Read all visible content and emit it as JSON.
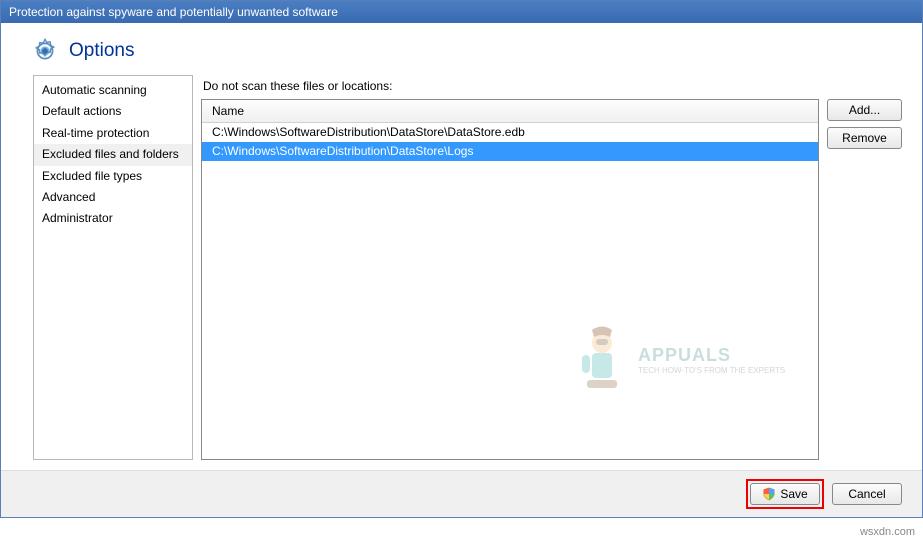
{
  "window": {
    "title": "Protection against spyware and potentially unwanted software"
  },
  "header": {
    "title": "Options"
  },
  "sidebar": {
    "items": [
      {
        "label": "Automatic scanning",
        "selected": false
      },
      {
        "label": "Default actions",
        "selected": false
      },
      {
        "label": "Real-time protection",
        "selected": false
      },
      {
        "label": "Excluded files and folders",
        "selected": true
      },
      {
        "label": "Excluded file types",
        "selected": false
      },
      {
        "label": "Advanced",
        "selected": false
      },
      {
        "label": "Administrator",
        "selected": false
      }
    ]
  },
  "main": {
    "section_label": "Do not scan these files or locations:",
    "column_header": "Name",
    "rows": [
      {
        "path": "C:\\Windows\\SoftwareDistribution\\DataStore\\DataStore.edb",
        "selected": false
      },
      {
        "path": "C:\\Windows\\SoftwareDistribution\\DataStore\\Logs",
        "selected": true
      }
    ]
  },
  "buttons": {
    "add": "Add...",
    "remove": "Remove",
    "save": "Save",
    "cancel": "Cancel"
  },
  "watermark": {
    "brand": "APPUALS",
    "tagline": "TECH HOW-TO'S FROM THE EXPERTS"
  },
  "credit": "wsxdn.com"
}
